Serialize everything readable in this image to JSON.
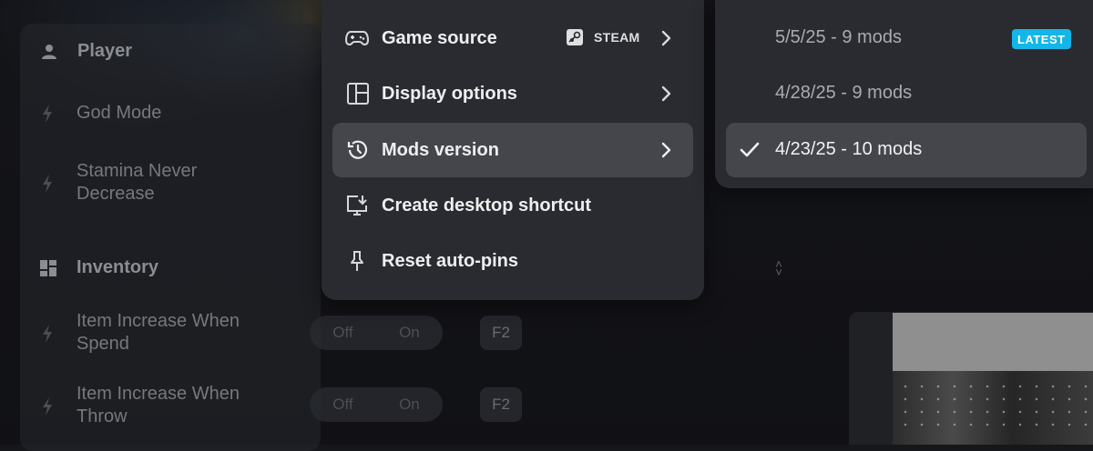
{
  "trainer": {
    "sections": [
      {
        "label": "Player",
        "icon": "person-icon"
      },
      {
        "label": "Inventory",
        "icon": "grid-icon"
      }
    ],
    "rows": [
      {
        "label": "God Mode"
      },
      {
        "label": "Stamina Never Decrease"
      },
      {
        "label": "Item Increase When Spend",
        "off": "Off",
        "on": "On",
        "hotkey": "F2"
      },
      {
        "label": "Item Increase When Throw",
        "off": "Off",
        "on": "On",
        "hotkey": "F2"
      }
    ]
  },
  "menu": {
    "items": [
      {
        "label": "Game source",
        "icon": "gamepad-icon",
        "badge_label": "STEAM",
        "badge_icon": "steam-icon"
      },
      {
        "label": "Display options",
        "icon": "layout-icon"
      },
      {
        "label": "Mods version",
        "icon": "history-icon",
        "active": true
      },
      {
        "label": "Create desktop shortcut",
        "icon": "desktop-shortcut-icon"
      },
      {
        "label": "Reset auto-pins",
        "icon": "pin-icon"
      }
    ]
  },
  "submenu": {
    "versions": [
      {
        "label": "5/5/25 - 9 mods",
        "tag": "LATEST"
      },
      {
        "label": "4/28/25 - 9 mods"
      },
      {
        "label": "4/23/25 - 10 mods",
        "selected": true
      }
    ]
  },
  "colors": {
    "accent": "#13b6e6",
    "menu_bg": "#2a2b30",
    "active_bg": "#45464c"
  }
}
